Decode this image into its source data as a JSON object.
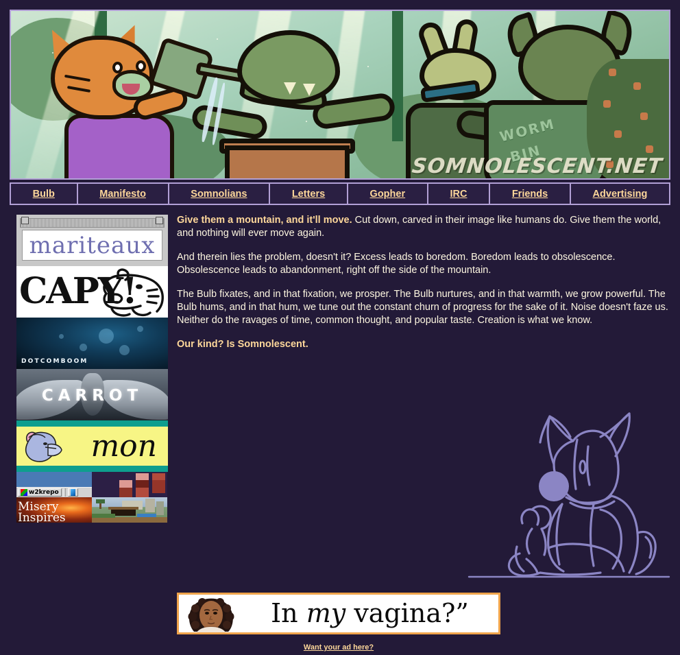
{
  "site": {
    "name": "Somnolescent",
    "banner_watermark": "SOMNOLESCENT.NET",
    "banner_alt": "Cartoon animal characters gardening in a greenhouse",
    "wormbin_label_line1": "WORM",
    "wormbin_label_line2": "BIN",
    "background_color": "#231a38",
    "border_color": "#b2a0d6",
    "link_color": "#fdd79a",
    "text_color": "#fdf6e0",
    "art_color": "#8b85c4"
  },
  "nav": {
    "items": [
      {
        "label": "Bulb",
        "name": "nav-bulb"
      },
      {
        "label": "Manifesto",
        "name": "nav-manifesto"
      },
      {
        "label": "Somnolians",
        "name": "nav-somnolians"
      },
      {
        "label": "Letters",
        "name": "nav-letters"
      },
      {
        "label": "Gopher",
        "name": "nav-gopher"
      },
      {
        "label": "IRC",
        "name": "nav-irc"
      },
      {
        "label": "Friends",
        "name": "nav-friends"
      },
      {
        "label": "Advertising",
        "name": "nav-advertising"
      }
    ]
  },
  "main": {
    "p1_lead": "Give them a mountain, and it'll move.",
    "p1_rest": " Cut down, carved in their image like humans do. Give them the world, and nothing will ever move again.",
    "p2": "And therein lies the problem, doesn't it? Excess leads to boredom. Boredom leads to obsolescence. Obsolescence leads to abandonment, right off the side of the mountain.",
    "p3": "The Bulb fixates, and in that fixation, we prosper. The Bulb nurtures, and in that warmth, we grow powerful. The Bulb hums, and in that hum, we tune out the constant churn of progress for the sake of it. Noise doesn't faze us. Neither do the ravages of time, common thought, and popular taste. Creation is what we know.",
    "p4": "Our kind? Is Somnolescent."
  },
  "sidebar": {
    "badges": [
      {
        "name": "badge-mariteaux",
        "label": "mariteaux",
        "style": "window-88x31"
      },
      {
        "name": "badge-capy",
        "label": "CAPY!",
        "style": "sketch-88x31"
      },
      {
        "name": "badge-dotcomboom",
        "label": "DOTCOMBOOM",
        "style": "photo-88x31"
      },
      {
        "name": "badge-carrot",
        "label": "CARROT",
        "style": "wings-88x31"
      },
      {
        "name": "badge-mon",
        "label": "mon",
        "style": "yellow-88x31"
      },
      {
        "name": "badge-w2krepo",
        "label": "w2krepo",
        "style": "win2k-88x31"
      },
      {
        "name": "badge-swatches",
        "label": "",
        "style": "swatch-88x31"
      },
      {
        "name": "badge-misery",
        "label": "Misery Inspires",
        "style": "fire-88x31"
      },
      {
        "name": "badge-minecraft",
        "label": "",
        "style": "minecraft-88x31"
      }
    ]
  },
  "ad": {
    "text_pre": "In ",
    "text_em": "my",
    "text_post": " vagina?”",
    "photo_alt": "Portrait of a woman",
    "cta": "Want your ad here?",
    "border_color": "#f0a44b"
  }
}
